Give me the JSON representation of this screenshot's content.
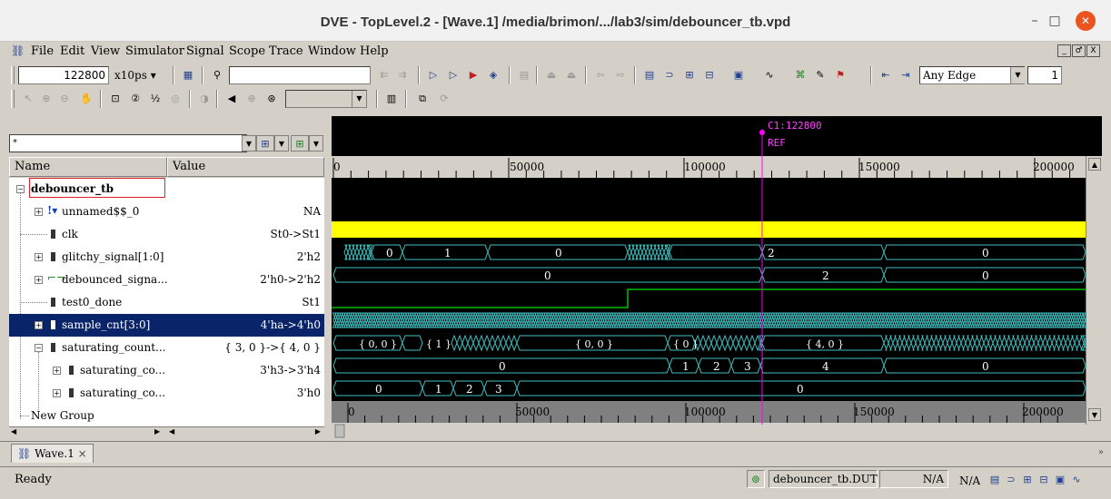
{
  "window": {
    "title": "DVE - TopLevel.2 - [Wave.1]  /media/brimon/.../lab3/sim/debouncer_tb.vpd",
    "minimize": "–",
    "maximize": "□",
    "close": "✕"
  },
  "menu": [
    "File",
    "Edit",
    "View",
    "Simulator",
    "Signal",
    "Scope",
    "Trace",
    "Window",
    "Help"
  ],
  "mdi_buttons": [
    "_",
    "♂",
    "X"
  ],
  "toolbar": {
    "time_value": "122800",
    "time_unit": "x10ps ▾",
    "search_value": "",
    "edge_select": "Any Edge",
    "edge_count": "1"
  },
  "signal_panel": {
    "filter_value": "*",
    "col_name": "Name",
    "col_value": "Value",
    "rows": [
      {
        "name": "debouncer_tb",
        "value": ""
      },
      {
        "name": "unnamed$$_0",
        "value": "NA"
      },
      {
        "name": "clk",
        "value": "St0->St1"
      },
      {
        "name": "glitchy_signal[1:0]",
        "value": "2'h2"
      },
      {
        "name": "debounced_signa...",
        "value": "2'h0->2'h2"
      },
      {
        "name": "test0_done",
        "value": "St1"
      },
      {
        "name": "sample_cnt[3:0]",
        "value": "4'ha->4'h0"
      },
      {
        "name": "saturating_count...",
        "value": "{ 3, 0 }->{ 4, 0 }"
      },
      {
        "name": "saturating_co...",
        "value": "3'h3->3'h4"
      },
      {
        "name": "saturating_co...",
        "value": "3'h0"
      },
      {
        "name": "New Group",
        "value": ""
      }
    ]
  },
  "wave": {
    "cursor_label": "C1:122800",
    "ref_label": "REF",
    "ruler_top": [
      "0",
      "50000",
      "100000",
      "150000",
      "200000"
    ],
    "ruler_bottom": [
      "0",
      "50000",
      "100000",
      "150000",
      "200000"
    ],
    "glitchy_values": [
      "0",
      "1",
      "0",
      "2",
      "0"
    ],
    "debounced_values": [
      "0",
      "2",
      "0"
    ],
    "sat_count_values": [
      "{ 0, 0 }",
      "{ 1 }",
      "{ 0, 0 }",
      "{ 0 }",
      "{ 4, 0 }"
    ],
    "sat_co1_values": [
      "0",
      "1",
      "2",
      "3",
      "4",
      "0"
    ],
    "sat_co2_values": [
      "0",
      "1",
      "2",
      "3",
      "0"
    ],
    "colors": {
      "bus": "#40c0c0",
      "clk_fill": "#ffff00",
      "logic": "#00c000",
      "cursor": "#ff00ff",
      "selected_row": "#0a246a"
    }
  },
  "tabs": [
    {
      "label": "Wave.1"
    }
  ],
  "statusbar": {
    "state": "Ready",
    "scope": "debouncer_tb.DUT",
    "na1": "N/A",
    "na2": "N/A"
  }
}
